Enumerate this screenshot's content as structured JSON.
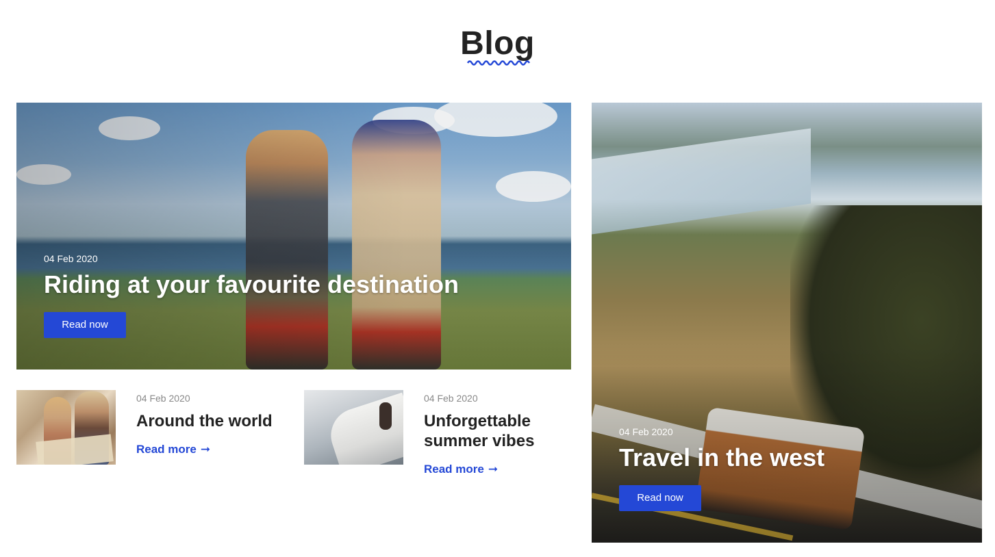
{
  "page": {
    "title": "Blog",
    "accent_color": "#2448d6"
  },
  "featured": [
    {
      "date": "04 Feb 2020",
      "title": "Riding at your favourite destination",
      "button_label": "Read now",
      "image": "cyclists-on-lakeside-path"
    },
    {
      "date": "04 Feb 2020",
      "title": "Travel in the west",
      "button_label": "Read now",
      "image": "van-driving-through-river-valley"
    }
  ],
  "posts": [
    {
      "date": "04 Feb 2020",
      "title": "Around the world",
      "link_label": "Read more",
      "link_icon": "arrow-right-icon",
      "image": "couple-with-map-selfie"
    },
    {
      "date": "04 Feb 2020",
      "title": "Unforgettable summer vibes",
      "link_label": "Read more",
      "link_icon": "arrow-right-icon",
      "image": "woman-on-yacht-deck"
    }
  ]
}
